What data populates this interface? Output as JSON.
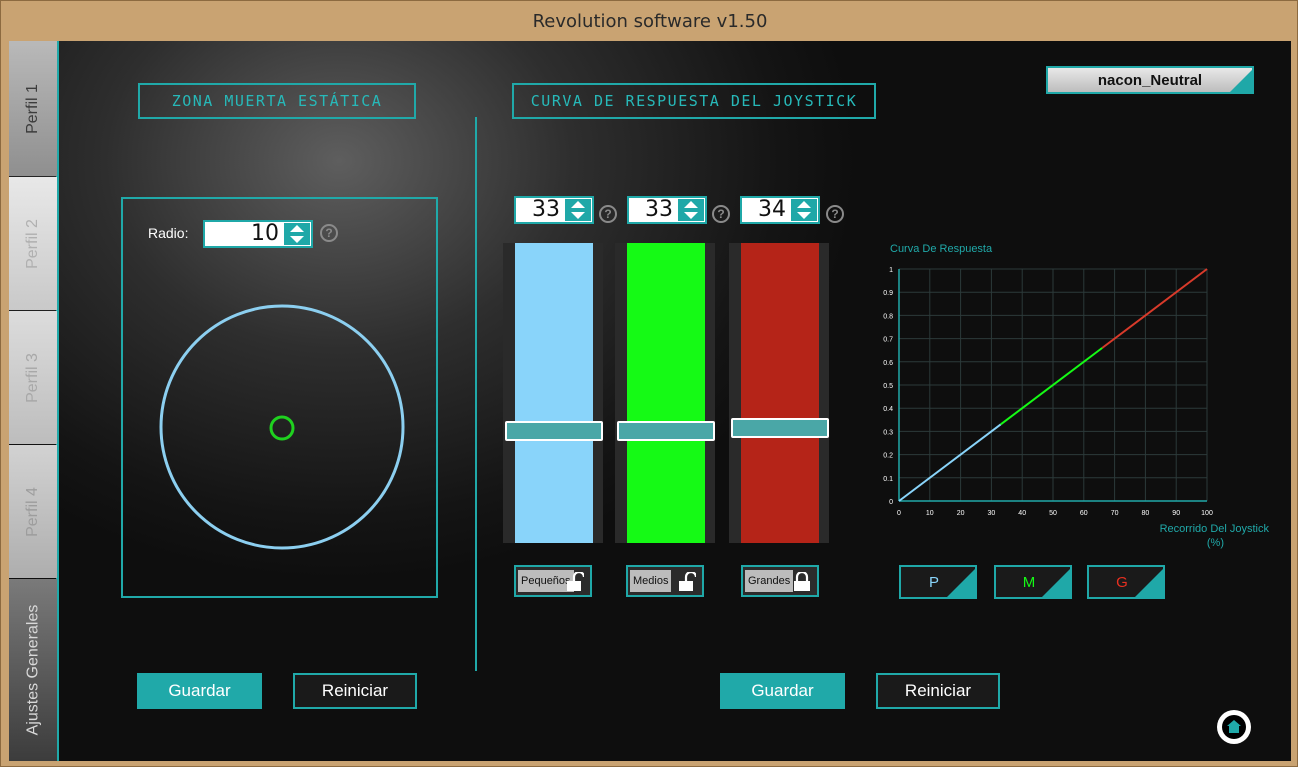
{
  "window": {
    "title": "Revolution software v1.50"
  },
  "sidebar": {
    "tabs": [
      {
        "label": "Perfil 1"
      },
      {
        "label": "Perfil 2"
      },
      {
        "label": "Perfil 3"
      },
      {
        "label": "Perfil 4"
      },
      {
        "label": "Ajustes Generales"
      }
    ],
    "active_tab": "Perfil 1"
  },
  "profile_selector": {
    "value": "nacon_Neutral"
  },
  "deadzone": {
    "title": "ZONA MUERTA ESTÁTICA",
    "radio_label": "Radio:",
    "radio_value": "10",
    "help_icon": "?",
    "save_label": "Guardar",
    "reset_label": "Reiniciar",
    "outer_ring_color": "#8ccff0",
    "inner_dot_color": "#1fd11f"
  },
  "response_curve": {
    "title": "CURVA DE RESPUESTA DEL JOYSTICK",
    "help_icon": "?",
    "sliders": [
      {
        "value": "33",
        "level": 0.33,
        "color": "#89d4fa",
        "lock_label": "Pequeños",
        "lock_icon": "unlocked-icon"
      },
      {
        "value": "33",
        "level": 0.33,
        "color": "#15fa15",
        "lock_label": "Medios",
        "lock_icon": "unlocked-icon"
      },
      {
        "value": "34",
        "level": 0.34,
        "color": "#b52418",
        "lock_label": "Grandes",
        "lock_icon": "locked-icon"
      }
    ],
    "curve_buttons": [
      {
        "label": "P",
        "color": "#89d4fa"
      },
      {
        "label": "M",
        "color": "#15fa15"
      },
      {
        "label": "G",
        "color": "#e83020"
      }
    ],
    "save_label": "Guardar",
    "reset_label": "Reiniciar"
  },
  "chart_data": {
    "type": "line",
    "title": "Curva De Respuesta",
    "xlabel": "Recorrido Del Joystick",
    "xunit": "(%)",
    "ylabel": "",
    "xlim": [
      0,
      100
    ],
    "ylim": [
      0,
      1
    ],
    "x_ticks": [
      "0",
      "10",
      "20",
      "30",
      "40",
      "50",
      "60",
      "70",
      "80",
      "90",
      "100"
    ],
    "y_ticks": [
      "0",
      "0.1",
      "0.2",
      "0.3",
      "0.4",
      "0.5",
      "0.6",
      "0.7",
      "0.8",
      "0.9",
      "1"
    ],
    "grid": true,
    "series": [
      {
        "x": [
          0,
          33
        ],
        "y": [
          0,
          0.33
        ],
        "color": "#89d4fa"
      },
      {
        "x": [
          33,
          66
        ],
        "y": [
          0.33,
          0.66
        ],
        "color": "#15fa15"
      },
      {
        "x": [
          66,
          100
        ],
        "y": [
          0.66,
          1
        ],
        "color": "#d83a2a"
      }
    ],
    "axis_color": "#20a9a9"
  },
  "footer": {
    "home_icon": "home-icon"
  }
}
